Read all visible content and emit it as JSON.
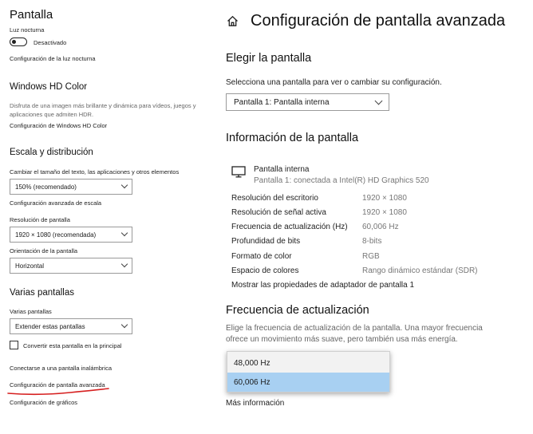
{
  "left": {
    "night_light": {
      "title": "Pantalla",
      "label": "Luz nocturna",
      "toggle_state": "Desactivado",
      "settings_link": "Configuración de la luz nocturna"
    },
    "hd_color": {
      "title": "Windows HD Color",
      "description": "Disfruta de una imagen más brillante y dinámica para vídeos, juegos y aplicaciones que admiten HDR.",
      "settings_link": "Configuración de Windows HD Color"
    },
    "scale": {
      "title": "Escala y distribución",
      "size_label": "Cambiar el tamaño del texto, las aplicaciones y otros elementos",
      "size_value": "150% (recomendado)",
      "advanced_scale_link": "Configuración avanzada de escala",
      "resolution_label": "Resolución de pantalla",
      "resolution_value": "1920 × 1080 (recomendada)",
      "orientation_label": "Orientación de la pantalla",
      "orientation_value": "Horizontal"
    },
    "multi": {
      "title": "Varias pantallas",
      "label": "Varias pantallas",
      "value": "Extender estas pantallas",
      "main_checkbox_label": "Convertir esta pantalla en la principal",
      "main_checkbox_checked": false,
      "wireless_link": "Conectarse a una pantalla inalámbrica",
      "advanced_link": "Configuración de pantalla avanzada",
      "graphics_link": "Configuración de gráficos"
    }
  },
  "right": {
    "title": "Configuración de pantalla avanzada",
    "choose": {
      "heading": "Elegir la pantalla",
      "instruction": "Selecciona una pantalla para ver o cambiar su configuración.",
      "selected_display": "Pantalla 1: Pantalla interna"
    },
    "info": {
      "heading": "Información de la pantalla",
      "display_name": "Pantalla interna",
      "display_sub": "Pantalla 1: conectada a Intel(R) HD Graphics 520",
      "rows": [
        {
          "label": "Resolución del escritorio",
          "value": "1920 × 1080"
        },
        {
          "label": "Resolución de señal activa",
          "value": "1920 × 1080"
        },
        {
          "label": "Frecuencia de actualización (Hz)",
          "value": "60,006 Hz"
        },
        {
          "label": "Profundidad de bits",
          "value": "8-bits"
        },
        {
          "label": "Formato de color",
          "value": "RGB"
        },
        {
          "label": "Espacio de colores",
          "value": "Rango dinámico estándar (SDR)"
        }
      ],
      "adapter_link": "Mostrar las propiedades de adaptador de pantalla 1"
    },
    "refresh": {
      "heading": "Frecuencia de actualización",
      "description": "Elige la frecuencia de actualización de la pantalla. Una mayor frecuencia ofrece un movimiento más suave, pero también usa más energía.",
      "options": [
        "48,000 Hz",
        "60,006 Hz"
      ],
      "selected_index": 1,
      "more_info_link": "Más información"
    }
  },
  "colors": {
    "link": "#0067b8",
    "selected_option": "#a8d0f2",
    "annotation_underline": "#d61f1f"
  }
}
